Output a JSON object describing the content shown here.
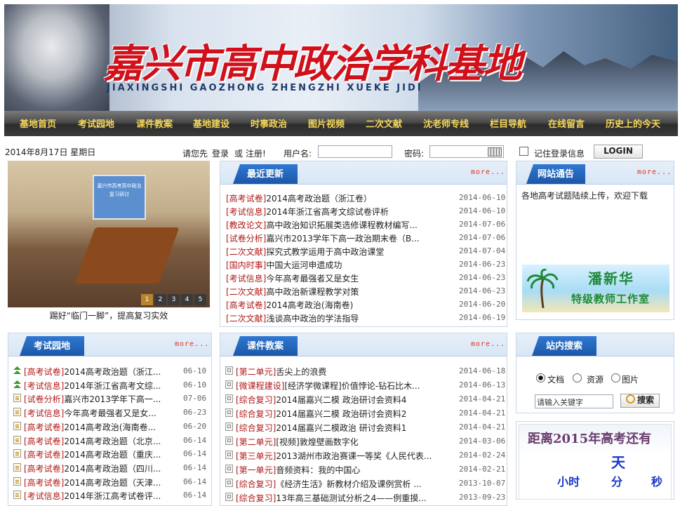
{
  "banner": {
    "title": "嘉兴市高中政治学科基地",
    "subtitle": "JIAXINGSHI GAOZHONG ZHENGZHI XUEKE JIDI"
  },
  "nav": [
    "基地首页",
    "考试园地",
    "课件教案",
    "基地建设",
    "时事政治",
    "图片视频",
    "二次文献",
    "沈老师专线",
    "栏目导航",
    "在线留言",
    "历史上的今天"
  ],
  "login": {
    "date": "2014年8月17日 星期日",
    "prompt": "请您先",
    "login_link": "登录",
    "or": "或",
    "register_link": "注册!",
    "username_label": "用户名:",
    "password_label": "密码:",
    "remember_label": "记住登录信息",
    "login_button": "LOGIN"
  },
  "slideshow": {
    "caption": "踢好“临门一脚”，提高复习实效",
    "screen_text": "嘉兴市高考高中政治复习研讨",
    "pages": [
      "1",
      "2",
      "3",
      "4",
      "5"
    ]
  },
  "recent": {
    "title": "最近更新",
    "more": "more...",
    "items": [
      {
        "cat": "[高考试卷]",
        "text": "2014高考政治题（浙江卷）",
        "date": "2014-06-10"
      },
      {
        "cat": "[考试信息]",
        "text": "2014年浙江省高考文综试卷评析",
        "date": "2014-06-10"
      },
      {
        "cat": "[教改论文]",
        "text": "高中政治知识拓展类选修课程教材编写...",
        "date": "2014-07-06"
      },
      {
        "cat": "[试卷分析]",
        "text": "嘉兴市2013学年下高一政治期末卷（B...",
        "date": "2014-07-06"
      },
      {
        "cat": "[二次文献]",
        "text": "探究式教学运用于高中政治课堂",
        "date": "2014-07-04"
      },
      {
        "cat": "[国内时事]",
        "text": "中国大运河申遗成功",
        "date": "2014-06-23"
      },
      {
        "cat": "[考试信息]",
        "text": "今年高考最强者又是女生",
        "date": "2014-06-23"
      },
      {
        "cat": "[二次文献]",
        "text": "高中政治新课程教学对策",
        "date": "2014-06-23"
      },
      {
        "cat": "[高考试卷]",
        "text": "2014高考政治(海南卷)",
        "date": "2014-06-20"
      },
      {
        "cat": "[二次文献]",
        "text": "浅谈高中政治的学法指导",
        "date": "2014-06-19"
      }
    ]
  },
  "notice": {
    "title": "网站通告",
    "more": "more...",
    "text": "各地高考试题陆续上传，欢迎下载",
    "studio_name": "潘新华",
    "studio_sub": "特级教师工作室"
  },
  "exam": {
    "title": "考试园地",
    "more": "more...",
    "items": [
      {
        "icon": "up-arrow-icon",
        "cat": "[高考试卷]",
        "text": "2014高考政治题（浙江...",
        "date": "06-10"
      },
      {
        "icon": "up-arrow-icon",
        "cat": "[考试信息]",
        "text": "2014年浙江省高考文综...",
        "date": "06-10"
      },
      {
        "icon": "document-icon",
        "cat": "[试卷分析]",
        "text": "嘉兴市2013学年下高一...",
        "date": "07-06"
      },
      {
        "icon": "document-icon",
        "cat": "[考试信息]",
        "text": "今年高考最强者又是女...",
        "date": "06-23"
      },
      {
        "icon": "document-icon",
        "cat": "[高考试卷]",
        "text": "2014高考政治(海南卷...",
        "date": "06-20"
      },
      {
        "icon": "document-icon",
        "cat": "[高考试卷]",
        "text": "2014高考政治题（北京...",
        "date": "06-14"
      },
      {
        "icon": "document-icon",
        "cat": "[高考试卷]",
        "text": "2014高考政治题（重庆...",
        "date": "06-14"
      },
      {
        "icon": "document-icon",
        "cat": "[高考试卷]",
        "text": "2014高考政治题（四川...",
        "date": "06-14"
      },
      {
        "icon": "document-icon",
        "cat": "[高考试卷]",
        "text": "2014高考政治题（天津...",
        "date": "06-14"
      },
      {
        "icon": "document-icon",
        "cat": "[考试信息]",
        "text": "2014年浙江高考试卷评...",
        "date": "06-14"
      }
    ]
  },
  "courseware": {
    "title": "课件教案",
    "more": "more...",
    "items": [
      {
        "cat": "[第二单元]",
        "text": "舌尖上的浪费",
        "date": "2014-06-18"
      },
      {
        "cat": "[微课程建设]",
        "text": "[经济学微课程]价值悖论-钻石比木...",
        "date": "2014-06-13"
      },
      {
        "cat": "[综合复习]",
        "text": "2014届嘉兴二模 政治研讨会资料4",
        "date": "2014-04-21"
      },
      {
        "cat": "[综合复习]",
        "text": "2014届嘉兴二模 政治研讨会资料2",
        "date": "2014-04-21"
      },
      {
        "cat": "[综合复习]",
        "text": "2014届嘉兴二模政治 研讨会资料1",
        "date": "2014-04-21"
      },
      {
        "cat": "[第二单元]",
        "text": "[视频]敦煌壁画数字化",
        "date": "2014-03-06"
      },
      {
        "cat": "[第三单元]",
        "text": "2013湖州市政治赛课一等奖《人民代表...",
        "date": "2014-02-24"
      },
      {
        "cat": "[第一单元]",
        "text": "音频资料：我的中国心",
        "date": "2014-02-21"
      },
      {
        "cat": "[综合复习]",
        "text": "《经济生活》新教材介绍及课例赏析 ...",
        "date": "2013-10-07"
      },
      {
        "cat": "[综合复习]",
        "text": "13年高三基础测试分析之4——例重摸...",
        "date": "2013-09-23"
      }
    ]
  },
  "site_search": {
    "title": "站内搜索",
    "options": [
      "文档",
      "资源",
      "图片"
    ],
    "placeholder": "请输入关键字",
    "button": "搜索"
  },
  "countdown": {
    "heading": "距离2015年高考还有",
    "day": "天",
    "hour": "小时",
    "minute": "分",
    "second": "秒"
  }
}
